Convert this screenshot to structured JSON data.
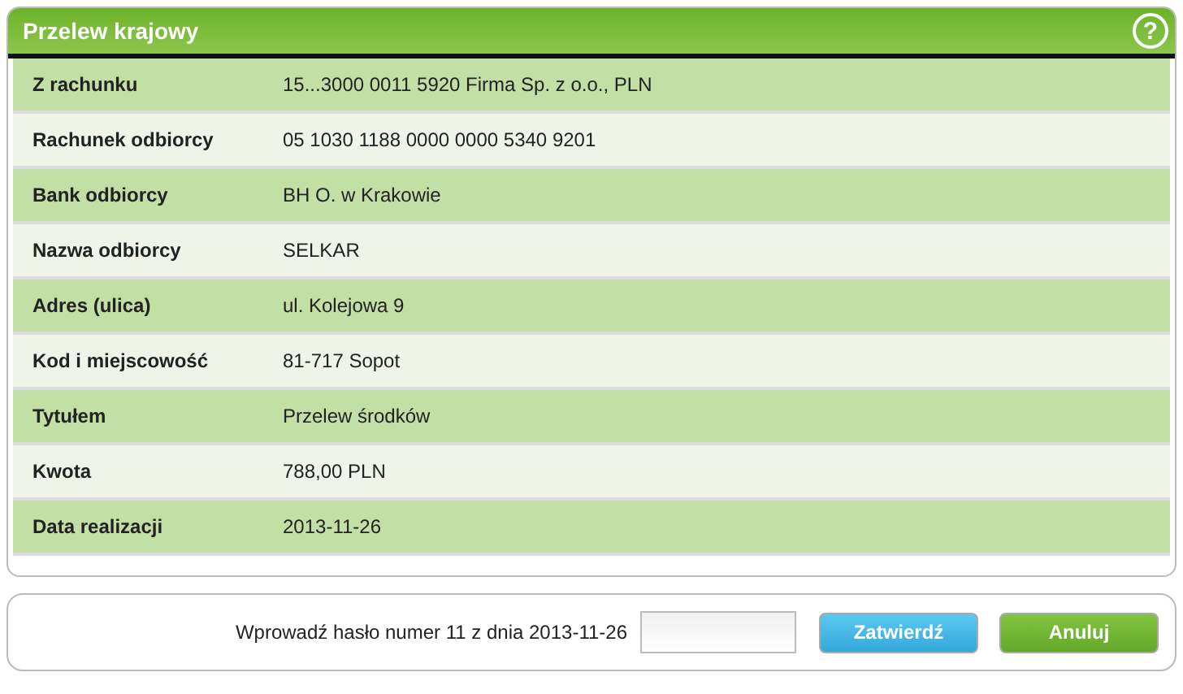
{
  "title": "Przelew krajowy",
  "help_icon": "?",
  "rows": [
    {
      "label": "Z rachunku",
      "value": "15...3000 0011 5920 Firma Sp. z o.o., PLN"
    },
    {
      "label": "Rachunek odbiorcy",
      "value": "05 1030 1188 0000 0000 5340 9201"
    },
    {
      "label": "Bank odbiorcy",
      "value": "BH O. w Krakowie"
    },
    {
      "label": "Nazwa odbiorcy",
      "value": "SELKAR"
    },
    {
      "label": "Adres (ulica)",
      "value": "ul. Kolejowa 9"
    },
    {
      "label": "Kod i miejscowość",
      "value": "81-717 Sopot"
    },
    {
      "label": "Tytułem",
      "value": "Przelew środków"
    },
    {
      "label": "Kwota",
      "value": "788,00  PLN"
    },
    {
      "label": "Data realizacji",
      "value": "2013-11-26"
    }
  ],
  "footer": {
    "prompt": "Wprowadź hasło numer 11 z dnia 2013-11-26",
    "buttons": [
      {
        "label": "Zatwierdź",
        "kind": "confirm"
      },
      {
        "label": "Anuluj",
        "kind": "cancel"
      }
    ]
  }
}
